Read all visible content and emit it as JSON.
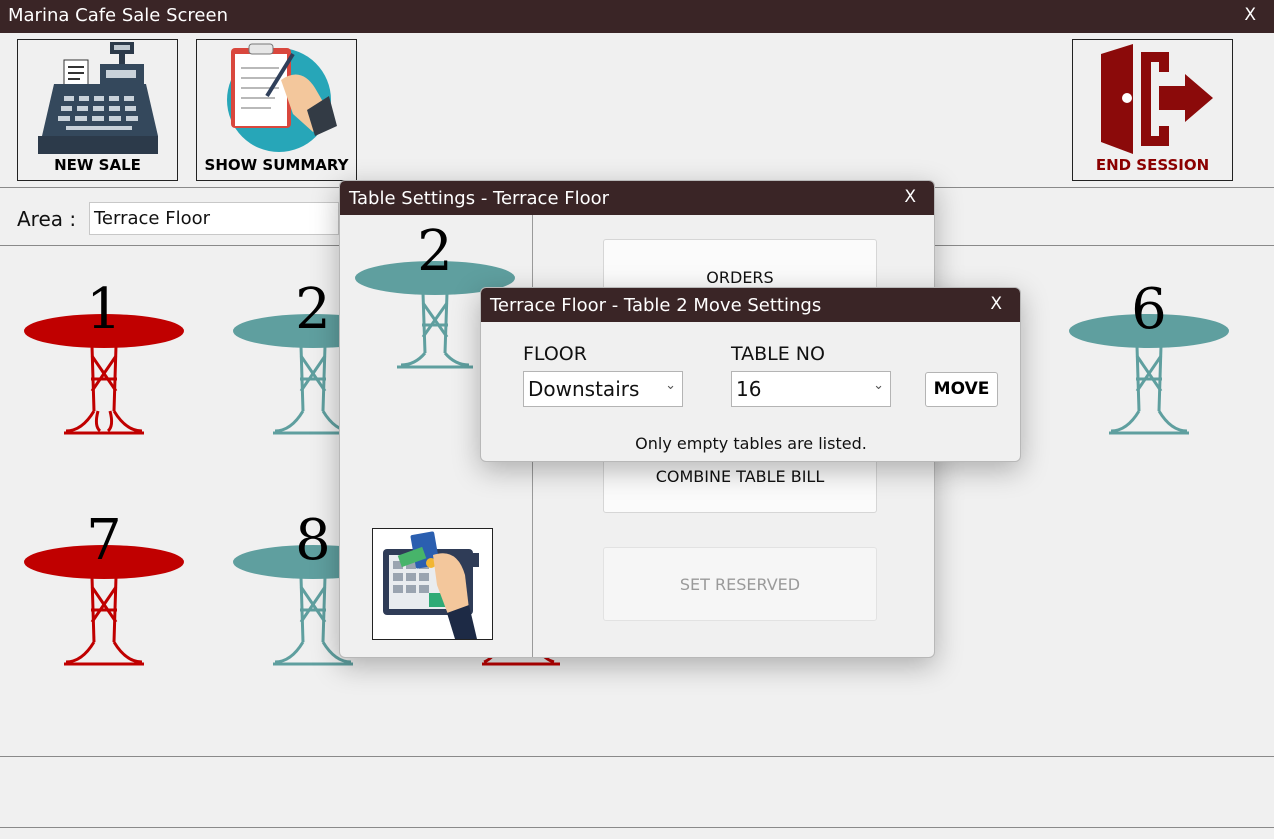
{
  "window": {
    "title": "Marina Cafe Sale Screen",
    "close_label": "X"
  },
  "toolbar": {
    "new_sale_label": "NEW SALE",
    "show_summary_label": "SHOW SUMMARY",
    "end_session_label": "END SESSION"
  },
  "area": {
    "label": "Area :",
    "value": "Terrace Floor"
  },
  "tables": [
    {
      "number": "1",
      "status": "occupied",
      "color": "#c00000"
    },
    {
      "number": "2",
      "status": "empty",
      "color": "#5f9f9f"
    },
    {
      "number": "6",
      "status": "empty",
      "color": "#5f9f9f"
    },
    {
      "number": "7",
      "status": "occupied",
      "color": "#c00000"
    },
    {
      "number": "8",
      "status": "empty",
      "color": "#5f9f9f"
    }
  ],
  "table_settings_dialog": {
    "title": "Table Settings - Terrace Floor",
    "close_label": "X",
    "table_number": "2",
    "buttons": {
      "orders": "ORDERS",
      "combine": "COMBINE TABLE BILL",
      "reserved": "SET RESERVED"
    }
  },
  "move_dialog": {
    "title": "Terrace Floor - Table 2 Move Settings",
    "close_label": "X",
    "floor_label": "FLOOR",
    "floor_value": "Downstairs",
    "table_label": "TABLE NO",
    "table_value": "16",
    "move_label": "MOVE",
    "note": "Only empty tables are listed."
  },
  "colors": {
    "titlebar": "#3a2526",
    "occupied": "#c00000",
    "empty": "#5f9f9f",
    "end_session": "#8b0000"
  }
}
